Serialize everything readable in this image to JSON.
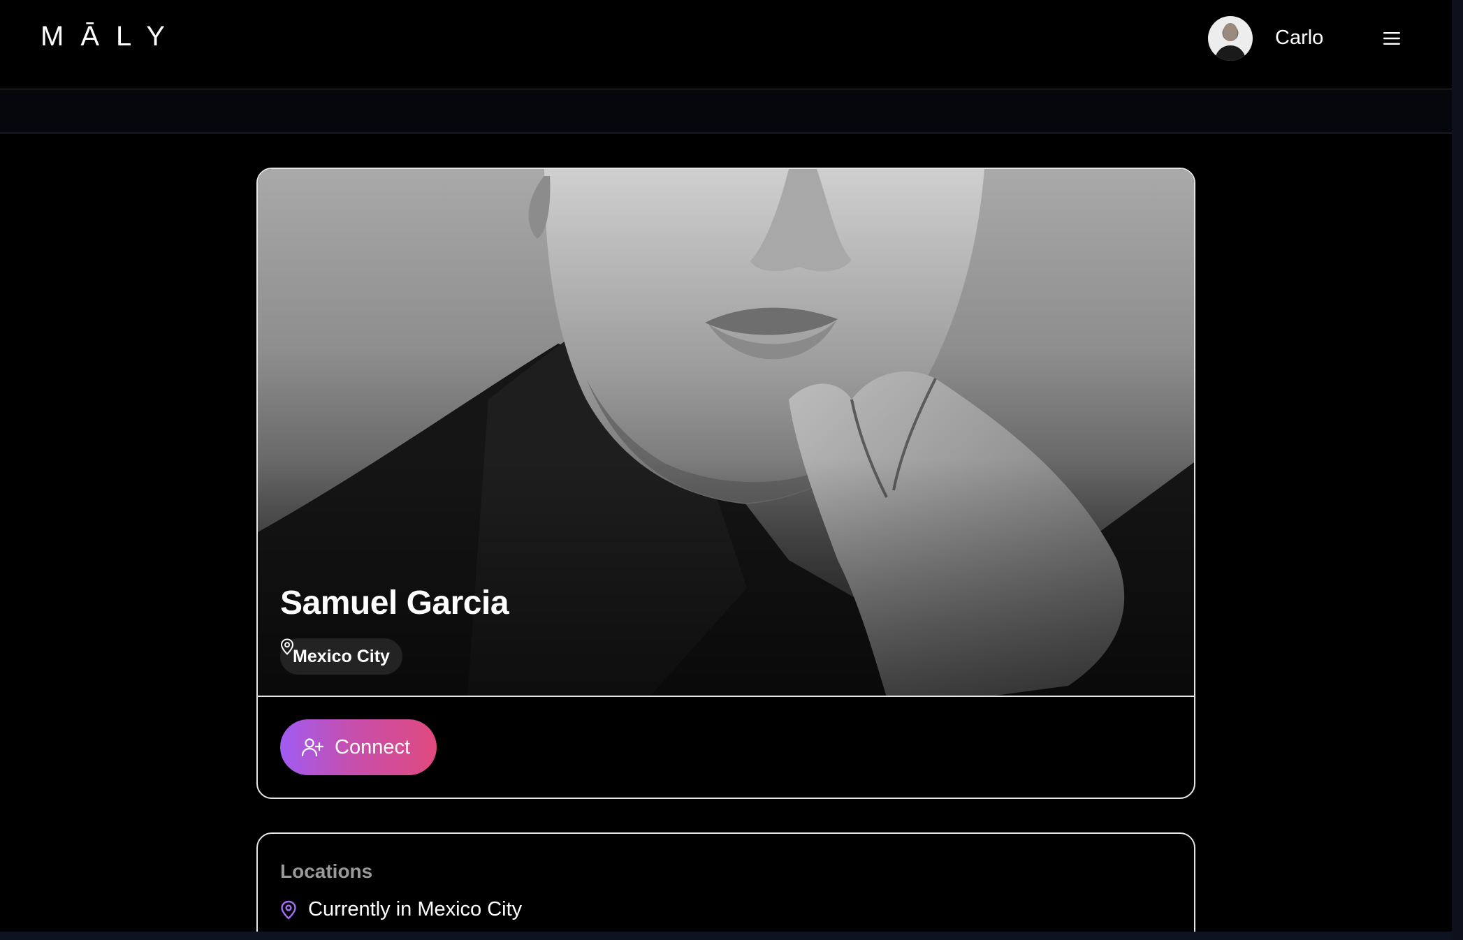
{
  "header": {
    "logo": "MĀLY",
    "user_name": "Carlo"
  },
  "profile": {
    "name": "Samuel Garcia",
    "location": "Mexico City",
    "connect_label": "Connect"
  },
  "locations": {
    "title": "Locations",
    "current_label": "Currently in Mexico City"
  },
  "icons": {
    "menu": "hamburger-menu-icon",
    "location_pin": "map-pin-icon",
    "connect": "user-plus-icon"
  },
  "colors": {
    "background": "#000000",
    "accent_gradient_start": "#a05cf3",
    "accent_gradient_end": "#e04a7e",
    "pin_accent": "#a66cf5",
    "muted_text": "#9a9a9a"
  }
}
